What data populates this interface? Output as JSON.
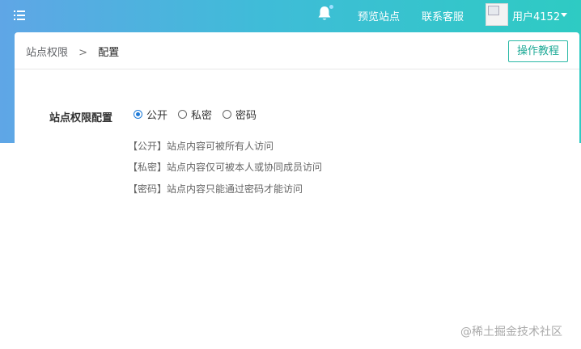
{
  "header": {
    "preview_label": "预览站点",
    "contact_label": "联系客服",
    "user_name": "用户4152"
  },
  "breadcrumb": {
    "parent": "站点权限",
    "separator": ">",
    "current": "配置"
  },
  "tutorial_button": "操作教程",
  "permission": {
    "label": "站点权限配置",
    "options": [
      {
        "label": "公开",
        "selected": true
      },
      {
        "label": "私密",
        "selected": false
      },
      {
        "label": "密码",
        "selected": false
      }
    ],
    "descriptions": [
      "【公开】站点内容可被所有人访问",
      "【私密】站点内容仅可被本人或协同成员访问",
      "【密码】站点内容只能通过密码才能访问"
    ]
  },
  "watermark": "@稀土掘金技术社区",
  "colors": {
    "accent": "#1e7bd8",
    "teal": "#2bb9a6",
    "gradient_start": "#5fa6e6",
    "gradient_end": "#2ecbc3"
  }
}
